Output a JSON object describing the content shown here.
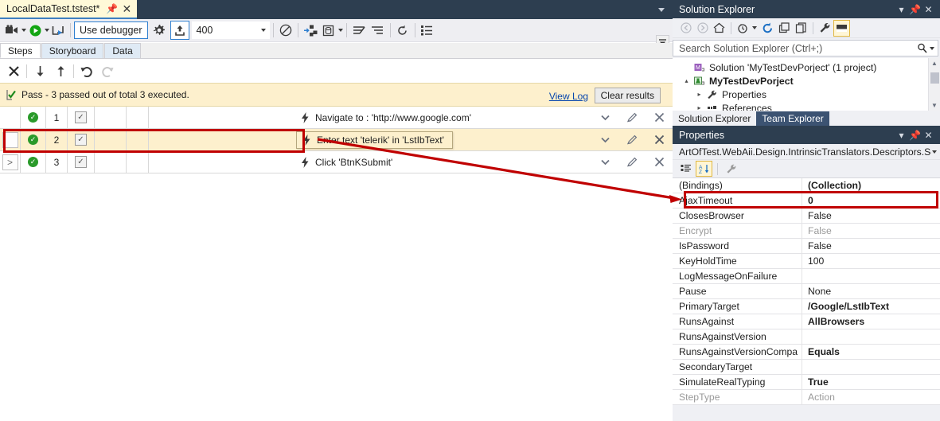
{
  "editor": {
    "tab": {
      "title": "LocalDataTest.tstest*",
      "pin_icon": "pin-icon",
      "close_icon": "close-icon"
    },
    "toolbar": {
      "record_icon": "record-camera-icon",
      "run_icon": "run-play-icon",
      "step_icon": "step-into-icon",
      "debugger_label": "Use debugger",
      "settings_icon": "gear-icon",
      "deploy_icon": "upload-icon",
      "speed_value": "400",
      "disable_icon": "no-entry-icon",
      "elements_icon": "elements-icon",
      "data_icon": "database-icon",
      "list_icon": "list-icon",
      "sort_icon": "sort-icon",
      "refresh_icon": "refresh-icon",
      "details_icon": "details-icon"
    },
    "inner_tabs": [
      {
        "label": "Steps",
        "active": true
      },
      {
        "label": "Storyboard",
        "active": false
      },
      {
        "label": "Data",
        "active": false
      }
    ],
    "step_toolbar": {
      "delete_icon": "x-delete-icon",
      "move_down_icon": "arrow-down-icon",
      "move_up_icon": "arrow-up-icon",
      "undo_icon": "undo-icon",
      "redo_icon": "redo-icon"
    },
    "results": {
      "status_icon": "pass-icon",
      "text": "Pass - 3 passed out of total 3 executed.",
      "view_log_label": "View Log",
      "clear_label": "Clear results"
    },
    "steps": [
      {
        "expander": "",
        "status": "pass",
        "num": "1",
        "checked": true,
        "icon": "lightning-icon",
        "description": "Navigate to : 'http://www.google.com'",
        "selected": false,
        "boxed": false,
        "chevron_icon": "chevron-down-icon",
        "edit_icon": "pencil-icon",
        "delete_icon": "x-icon"
      },
      {
        "expander": "",
        "status": "pass",
        "num": "2",
        "checked": true,
        "icon": "lightning-icon",
        "description": "Enter text 'telerik' in 'LstIbText'",
        "selected": true,
        "boxed": true,
        "chevron_icon": "chevron-down-icon",
        "edit_icon": "pencil-icon",
        "delete_icon": "x-icon"
      },
      {
        "expander": ">",
        "status": "pass",
        "num": "3",
        "checked": true,
        "icon": "lightning-icon",
        "description": "Click 'BtnKSubmit'",
        "selected": false,
        "boxed": false,
        "chevron_icon": "chevron-down-icon",
        "edit_icon": "pencil-icon",
        "delete_icon": "x-icon"
      }
    ]
  },
  "solution_explorer": {
    "title": "Solution Explorer",
    "dropdown_icon": "chevron-down-icon",
    "pin_icon": "pin-icon",
    "close_icon": "close-icon",
    "toolbar": {
      "back_icon": "back-arrow-icon",
      "forward_icon": "forward-arrow-icon",
      "home_icon": "home-icon",
      "pending_changes_icon": "clock-icon",
      "refresh_icon": "refresh-icon",
      "collapse_icon": "collapse-all-icon",
      "show_all_icon": "show-all-files-icon",
      "properties_icon": "wrench-icon",
      "preview_icon": "preview-pane-icon"
    },
    "search_placeholder": "Search Solution Explorer (Ctrl+;)",
    "search_icon": "search-icon",
    "search_dropdown_icon": "chevron-down-icon",
    "tree": [
      {
        "arrow": "",
        "icon": "solution-icon",
        "label": "Solution 'MyTestDevPorject' (1 project)",
        "bold": false,
        "indent": 6
      },
      {
        "arrow": "▴",
        "icon": "project-icon",
        "label": "MyTestDevPorject",
        "bold": true,
        "indent": 6
      },
      {
        "arrow": "▸",
        "icon": "wrench-icon",
        "label": "Properties",
        "bold": false,
        "indent": 22
      },
      {
        "arrow": "▸",
        "icon": "references-icon",
        "label": "References",
        "bold": false,
        "indent": 22
      }
    ],
    "tabs": [
      {
        "label": "Solution Explorer",
        "active": true
      },
      {
        "label": "Team Explorer",
        "active": false
      }
    ]
  },
  "properties": {
    "title": "Properties",
    "dropdown_icon": "chevron-down-icon",
    "pin_icon": "pin-icon",
    "close_icon": "close-icon",
    "object_name": "ArtOfTest.WebAii.Design.IntrinsicTranslators.Descriptors.Se",
    "object_dropdown_icon": "chevron-down-icon",
    "toolbar": {
      "categorized_icon": "categorized-icon",
      "alphabetical_icon": "alphabetical-sort-icon",
      "property_pages_icon": "wrench-icon"
    },
    "rows": [
      {
        "name": "(Bindings)",
        "value": "(Collection)",
        "bold": true,
        "dim": false,
        "highlight": true
      },
      {
        "name": "AjaxTimeout",
        "value": "0",
        "bold": true,
        "dim": false,
        "highlight": false
      },
      {
        "name": "ClosesBrowser",
        "value": "False",
        "bold": false,
        "dim": false,
        "highlight": false
      },
      {
        "name": "Encrypt",
        "value": "False",
        "bold": false,
        "dim": true,
        "highlight": false
      },
      {
        "name": "IsPassword",
        "value": "False",
        "bold": false,
        "dim": false,
        "highlight": false
      },
      {
        "name": "KeyHoldTime",
        "value": "100",
        "bold": false,
        "dim": false,
        "highlight": false
      },
      {
        "name": "LogMessageOnFailure",
        "value": "",
        "bold": false,
        "dim": false,
        "highlight": false
      },
      {
        "name": "Pause",
        "value": "None",
        "bold": false,
        "dim": false,
        "highlight": false
      },
      {
        "name": "PrimaryTarget",
        "value": "/Google/LstIbText",
        "bold": true,
        "dim": false,
        "highlight": false
      },
      {
        "name": "RunsAgainst",
        "value": "AllBrowsers",
        "bold": true,
        "dim": false,
        "highlight": false
      },
      {
        "name": "RunsAgainstVersion",
        "value": "",
        "bold": false,
        "dim": false,
        "highlight": false
      },
      {
        "name": "RunsAgainstVersionCompa",
        "value": "Equals",
        "bold": true,
        "dim": false,
        "highlight": false
      },
      {
        "name": "SecondaryTarget",
        "value": "",
        "bold": false,
        "dim": false,
        "highlight": false
      },
      {
        "name": "SimulateRealTyping",
        "value": "True",
        "bold": true,
        "dim": false,
        "highlight": false
      },
      {
        "name": "StepType",
        "value": "Action",
        "bold": false,
        "dim": true,
        "highlight": false
      }
    ]
  },
  "annotations": {
    "accent_color": "#c00000",
    "step_row_box": "red-rectangle-step-2",
    "bindings_box": "red-rectangle-bindings-row",
    "arrow": "red-arrow-step-to-bindings"
  }
}
